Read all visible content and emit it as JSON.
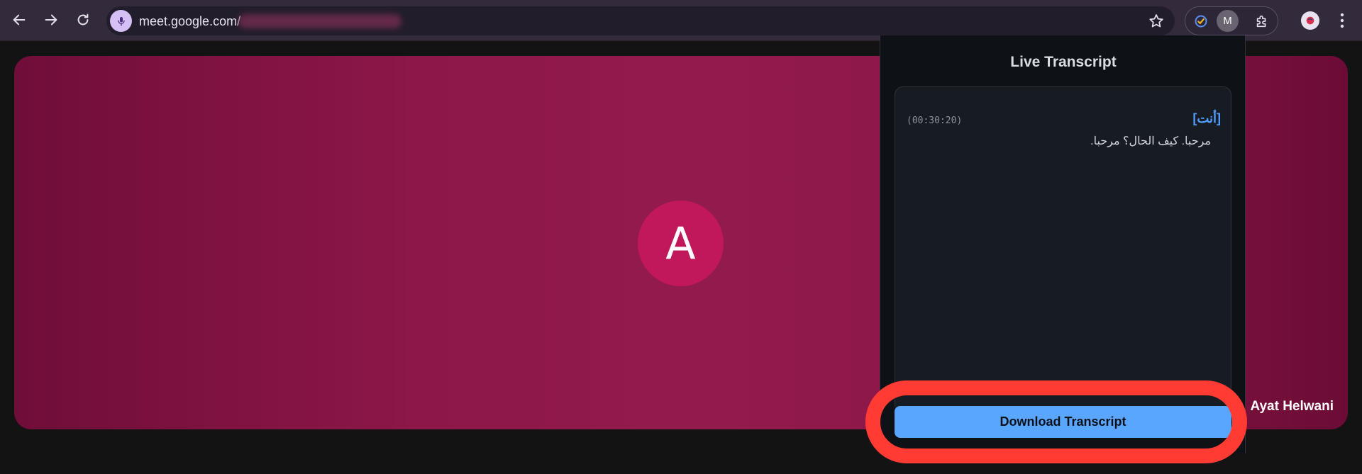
{
  "browser": {
    "url": "meet.google.com/",
    "extension_badge": "M",
    "icons": {
      "back": "arrow-left-icon",
      "forward": "arrow-right-icon",
      "reload": "reload-icon",
      "mic": "microphone-icon",
      "bookmark": "star-icon",
      "extension_check": "check-circle-icon",
      "extensions": "puzzle-icon",
      "profile": "profile-avatar-icon",
      "menu": "kebab-menu-icon"
    }
  },
  "meeting": {
    "avatar_initial": "A",
    "participant_name": "Ayat Helwani",
    "tile_color": "#8c1748",
    "avatar_color": "#c0185a"
  },
  "transcript": {
    "title": "Live Transcript",
    "entries": [
      {
        "speaker": "[أنت]",
        "timestamp": "(00:30:20)",
        "text": "مرحبا. كيف الحال؟ مرحبا."
      }
    ],
    "download_label": "Download Transcript",
    "button_color": "#58a6ff",
    "highlight_color": "#ff3b34"
  }
}
